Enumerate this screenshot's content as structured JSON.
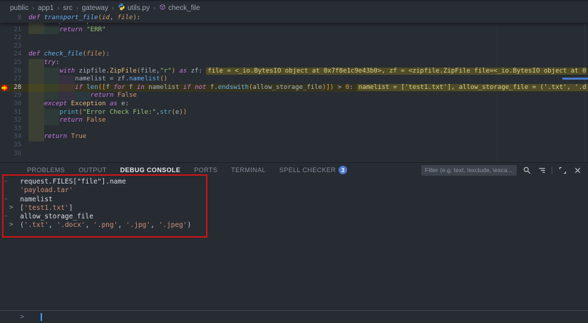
{
  "breadcrumb": {
    "items": [
      "public",
      "app1",
      "src",
      "gateway"
    ],
    "file": "utils.py",
    "symbol": "check_file"
  },
  "editor": {
    "sticky": {
      "n": 8,
      "ind": 0,
      "seg": [
        [
          "def ",
          "kw"
        ],
        [
          "transport_file",
          "fn"
        ],
        [
          "(",
          "brk"
        ],
        [
          "id",
          "param"
        ],
        [
          ", ",
          "plain"
        ],
        [
          "file",
          "param"
        ],
        [
          ")",
          "brk"
        ],
        [
          ":",
          "plain"
        ]
      ]
    },
    "clipped": {
      "ind": 1,
      "seg": [
        [
          "except ",
          "kw"
        ],
        [
          "Exception",
          "cls"
        ],
        [
          " as ",
          "kw"
        ],
        [
          "e:",
          "plain"
        ]
      ]
    },
    "lines": [
      {
        "n": 21,
        "ind": 2,
        "seg": [
          [
            "return ",
            "kw"
          ],
          [
            "\"ERR\"",
            "str"
          ]
        ]
      },
      {
        "n": 22,
        "ind": 0,
        "seg": []
      },
      {
        "n": 23,
        "ind": 0,
        "seg": []
      },
      {
        "n": 24,
        "ind": 0,
        "seg": [
          [
            "def ",
            "kw"
          ],
          [
            "check_file",
            "fn"
          ],
          [
            "(",
            "brk"
          ],
          [
            "file",
            "param"
          ],
          [
            ")",
            "brk"
          ],
          [
            ":",
            "plain"
          ]
        ]
      },
      {
        "n": 25,
        "ind": 1,
        "seg": [
          [
            "try",
            "kw"
          ],
          [
            ":",
            "plain"
          ]
        ]
      },
      {
        "n": 26,
        "ind": 2,
        "seg": [
          [
            "with ",
            "kw"
          ],
          [
            "zipfile.",
            "plain"
          ],
          [
            "ZipFile",
            "cls"
          ],
          [
            "(",
            "brk"
          ],
          [
            "file",
            "plain"
          ],
          [
            ",",
            "plain"
          ],
          [
            "\"r\"",
            "str"
          ],
          [
            ")",
            "brk"
          ],
          [
            " as ",
            "kw"
          ],
          [
            "zf:",
            "plain"
          ]
        ],
        "hint": "file = <_io.BytesIO object at 0x7f8e1c9e43b0>, zf = <zipfile.ZipFile file=<_io.BytesIO object at 0"
      },
      {
        "n": 27,
        "ind": 3,
        "seg": [
          [
            "namelist = zf.",
            "plain"
          ],
          [
            "namelist",
            "fnc"
          ],
          [
            "()",
            "brk"
          ]
        ]
      },
      {
        "n": 28,
        "ind": 3,
        "cur": true,
        "bp": true,
        "seg": [
          [
            "if ",
            "kw"
          ],
          [
            "len",
            "fnc"
          ],
          [
            "([",
            "brk"
          ],
          [
            "f ",
            "plain"
          ],
          [
            "for",
            "kw"
          ],
          [
            " f ",
            "plain"
          ],
          [
            "in",
            "kw"
          ],
          [
            " namelist ",
            "plain"
          ],
          [
            "if",
            "kw"
          ],
          [
            " ",
            "plain"
          ],
          [
            "not",
            "kw"
          ],
          [
            " f.",
            "plain"
          ],
          [
            "endswith",
            "fnc"
          ],
          [
            "(",
            "brk"
          ],
          [
            "allow_storage_file",
            "plain"
          ],
          [
            ")])",
            "brk"
          ],
          [
            " > ",
            "plain"
          ],
          [
            "0",
            "const"
          ],
          [
            ":",
            "plain"
          ]
        ],
        "hint": "namelist = ['test1.txt'], allow_storage_file = ('.txt', '.d"
      },
      {
        "n": 29,
        "ind": 4,
        "seg": [
          [
            "return ",
            "kw"
          ],
          [
            "False",
            "const"
          ]
        ]
      },
      {
        "n": 30,
        "ind": 1,
        "seg": [
          [
            "except ",
            "kw"
          ],
          [
            "Exception",
            "cls"
          ],
          [
            " as ",
            "kw"
          ],
          [
            "e:",
            "plain"
          ]
        ]
      },
      {
        "n": 31,
        "ind": 2,
        "seg": [
          [
            "print",
            "bi"
          ],
          [
            "(",
            "brk"
          ],
          [
            "\"Error Check File:\"",
            "str"
          ],
          [
            ",",
            "plain"
          ],
          [
            "str",
            "bi"
          ],
          [
            "(",
            "brk"
          ],
          [
            "e",
            "plain"
          ],
          [
            "))",
            "brk"
          ]
        ]
      },
      {
        "n": 32,
        "ind": 2,
        "seg": [
          [
            "return ",
            "kw"
          ],
          [
            "False",
            "const"
          ]
        ]
      },
      {
        "n": 33,
        "ind": 1,
        "seg": []
      },
      {
        "n": 34,
        "ind": 1,
        "seg": [
          [
            "return ",
            "kw"
          ],
          [
            "True",
            "const"
          ]
        ]
      },
      {
        "n": 35,
        "ind": 0,
        "seg": []
      },
      {
        "n": 36,
        "ind": 0,
        "seg": []
      }
    ]
  },
  "panel": {
    "tabs": [
      {
        "label": "PROBLEMS"
      },
      {
        "label": "OUTPUT"
      },
      {
        "label": "DEBUG CONSOLE",
        "active": true
      },
      {
        "label": "PORTS"
      },
      {
        "label": "TERMINAL"
      },
      {
        "label": "SPELL CHECKER",
        "badge": "3"
      }
    ],
    "filter_placeholder": "Filter (e.g. text, !exclude, \\esca...",
    "console": {
      "rows": [
        {
          "kind": "input",
          "text": "request.FILES[\"file\"].name"
        },
        {
          "kind": "result",
          "seg": [
            [
              "'payload.tar'",
              "cstr"
            ]
          ]
        },
        {
          "kind": "input",
          "text": "namelist"
        },
        {
          "kind": "expand",
          "seg": [
            [
              "[",
              "cpun"
            ],
            [
              "'test1.txt'",
              "cstr"
            ],
            [
              "]",
              "cpun"
            ]
          ]
        },
        {
          "kind": "input",
          "text": "allow_storage_file"
        },
        {
          "kind": "expand",
          "seg": [
            [
              "(",
              "cpun"
            ],
            [
              "'.txt'",
              "cstr"
            ],
            [
              ", ",
              "cpun"
            ],
            [
              "'.docx'",
              "cstr"
            ],
            [
              ", ",
              "cpun"
            ],
            [
              "'.png'",
              "cstr"
            ],
            [
              ", ",
              "cpun"
            ],
            [
              "'.jpg'",
              "cstr"
            ],
            [
              ", ",
              "cpun"
            ],
            [
              "'.jpeg'",
              "cstr"
            ],
            [
              ")",
              "cpun"
            ]
          ]
        }
      ],
      "prompt": ">"
    }
  },
  "icons": {
    "python_blue": "#4584b6",
    "python_yellow": "#ffde57",
    "method_symbol": "#b180d7",
    "badge_blue": "#4d78cc",
    "breakpoint_red": "#e51400",
    "breakpoint_arrow_yellow": "#ffcc00",
    "annotation_red": "#cb1515",
    "caret_blue": "#3f96ff",
    "overview_mark_blue": "#4879c4"
  }
}
